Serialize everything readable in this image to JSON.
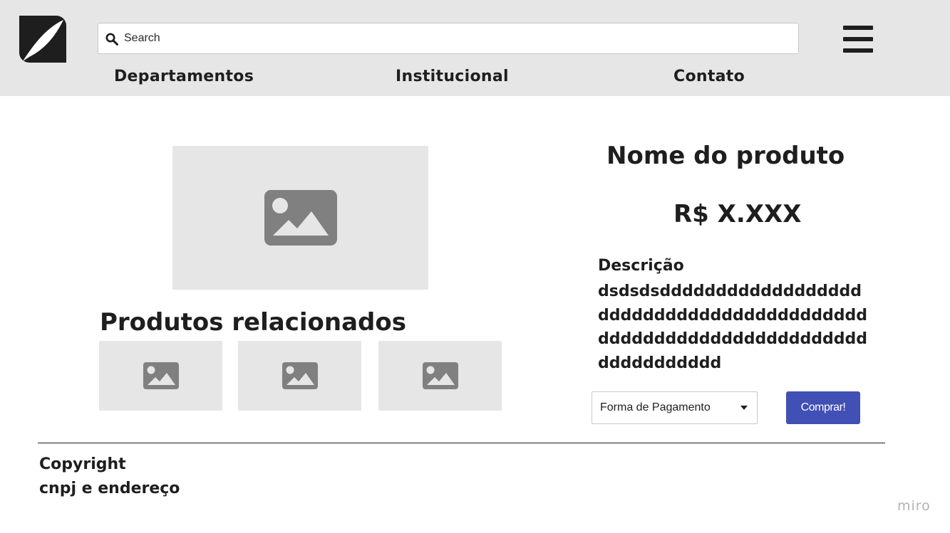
{
  "header": {
    "logo_icon": "quill-icon",
    "search": {
      "placeholder": "Search",
      "value": "",
      "icon": "search-icon"
    },
    "menu_icon": "hamburger-menu-icon",
    "nav": [
      {
        "label": "Departamentos"
      },
      {
        "label": "Institucional"
      },
      {
        "label": "Contato"
      }
    ]
  },
  "product": {
    "image_icon": "image-placeholder-icon",
    "name": "Nome do produto",
    "price": "R$ X.XXX",
    "description_title": "Descrição",
    "description_text": "dsdsdsddddddddddddddddddddddddddddddddddddddddddddddddddddddddddddddddddddddddddddd",
    "payment_select": {
      "selected": "Forma de Pagamento"
    },
    "buy_label": "Comprar!"
  },
  "related": {
    "title": "Produtos relacionados",
    "items": [
      {
        "icon": "image-placeholder-icon"
      },
      {
        "icon": "image-placeholder-icon"
      },
      {
        "icon": "image-placeholder-icon"
      }
    ]
  },
  "footer": {
    "copyright": "Copyright",
    "info": "cnpj e endereço"
  },
  "watermark": "miro",
  "colors": {
    "header_bg": "#e6e6e6",
    "placeholder_bg": "#e6e6e6",
    "placeholder_icon": "#808080",
    "text": "#1e1e1e",
    "buy_button": "#4050b5",
    "watermark": "#b3b3b3"
  }
}
